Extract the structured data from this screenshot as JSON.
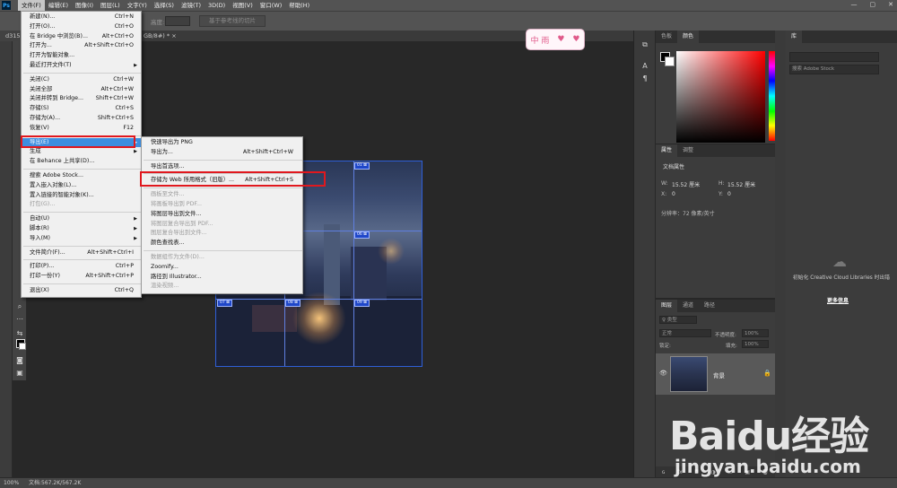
{
  "menubar": {
    "logo": "Ps",
    "items": [
      "文件(F)",
      "编辑(E)",
      "图像(I)",
      "图层(L)",
      "文字(Y)",
      "选择(S)",
      "滤镜(T)",
      "3D(D)",
      "视图(V)",
      "窗口(W)",
      "帮助(H)"
    ],
    "window_controls": [
      "—",
      "▢",
      "✕"
    ]
  },
  "options_bar": {
    "field_label": "高度:",
    "button": "基于参考线的切片"
  },
  "doc_tab": {
    "left": "d315",
    "title": "GB/8#) *",
    "close": "×"
  },
  "file_menu": [
    {
      "label": "新建(N)...",
      "shortcut": "Ctrl+N"
    },
    {
      "label": "打开(O)...",
      "shortcut": "Ctrl+O"
    },
    {
      "label": "在 Bridge 中浏览(B)...",
      "shortcut": "Alt+Ctrl+O"
    },
    {
      "label": "打开为...",
      "shortcut": "Alt+Shift+Ctrl+O"
    },
    {
      "label": "打开为智能对象...",
      "shortcut": ""
    },
    {
      "label": "最近打开文件(T)",
      "shortcut": "",
      "arrow": "▶"
    },
    {
      "sep": true
    },
    {
      "label": "关闭(C)",
      "shortcut": "Ctrl+W"
    },
    {
      "label": "关闭全部",
      "shortcut": "Alt+Ctrl+W"
    },
    {
      "label": "关闭并转到 Bridge...",
      "shortcut": "Shift+Ctrl+W"
    },
    {
      "label": "存储(S)",
      "shortcut": "Ctrl+S"
    },
    {
      "label": "存储为(A)...",
      "shortcut": "Shift+Ctrl+S"
    },
    {
      "label": "恢复(V)",
      "shortcut": "F12"
    },
    {
      "sep": true
    },
    {
      "label": "导出(E)",
      "shortcut": "",
      "arrow": "▶",
      "highlight": true
    },
    {
      "label": "生成",
      "shortcut": "",
      "arrow": "▶"
    },
    {
      "label": "在 Behance 上共享(D)...",
      "shortcut": ""
    },
    {
      "sep": true
    },
    {
      "label": "搜索 Adobe Stock...",
      "shortcut": ""
    },
    {
      "label": "置入嵌入对象(L)...",
      "shortcut": ""
    },
    {
      "label": "置入链接的智能对象(K)...",
      "shortcut": ""
    },
    {
      "label": "打包(G)...",
      "shortcut": "",
      "disabled": true
    },
    {
      "sep": true
    },
    {
      "label": "自动(U)",
      "shortcut": "",
      "arrow": "▶"
    },
    {
      "label": "脚本(R)",
      "shortcut": "",
      "arrow": "▶"
    },
    {
      "label": "导入(M)",
      "shortcut": "",
      "arrow": "▶"
    },
    {
      "sep": true
    },
    {
      "label": "文件简介(F)...",
      "shortcut": "Alt+Shift+Ctrl+I"
    },
    {
      "sep": true
    },
    {
      "label": "打印(P)...",
      "shortcut": "Ctrl+P"
    },
    {
      "label": "打印一份(Y)",
      "shortcut": "Alt+Shift+Ctrl+P"
    },
    {
      "sep": true
    },
    {
      "label": "退出(X)",
      "shortcut": "Ctrl+Q"
    }
  ],
  "export_submenu": [
    {
      "label": "快速导出为 PNG",
      "shortcut": ""
    },
    {
      "label": "导出为...",
      "shortcut": "Alt+Shift+Ctrl+W"
    },
    {
      "sep": true
    },
    {
      "label": "导出首选项...",
      "shortcut": ""
    },
    {
      "sep": true
    },
    {
      "label": "存储为 Web 所用格式（旧版）...",
      "shortcut": "Alt+Shift+Ctrl+S"
    },
    {
      "sep": true
    },
    {
      "label": "画板至文件...",
      "shortcut": "",
      "disabled": true
    },
    {
      "label": "将画板导出到 PDF...",
      "shortcut": "",
      "disabled": true
    },
    {
      "label": "将图层导出到文件...",
      "shortcut": ""
    },
    {
      "label": "将图层复合导出到 PDF...",
      "shortcut": "",
      "disabled": true
    },
    {
      "label": "图层复合导出到文件...",
      "shortcut": "",
      "disabled": true
    },
    {
      "label": "颜色查找表...",
      "shortcut": ""
    },
    {
      "sep": true
    },
    {
      "label": "数据组作为文件(D)...",
      "shortcut": "",
      "disabled": true
    },
    {
      "label": "Zoomify...",
      "shortcut": ""
    },
    {
      "label": "路径到 Illustrator...",
      "shortcut": ""
    },
    {
      "label": "渲染视频...",
      "shortcut": "",
      "disabled": true
    }
  ],
  "slices": [
    "01 ⊠",
    "06 ⊠",
    "07 ⊠",
    "08 ⊠",
    "09 ⊠"
  ],
  "sticker_text": "中 雨",
  "color_panel": {
    "tabs": [
      "色板",
      "颜色"
    ]
  },
  "properties_panel": {
    "tabs": [
      "属性",
      "调整"
    ],
    "section": "文档属性",
    "w_label": "W:",
    "w_value": "15.52 厘米",
    "h_label": "H:",
    "h_value": "15.52 厘米",
    "x_label": "X:",
    "x_value": "0",
    "y_label": "Y:",
    "y_value": "0",
    "resolution": "分辨率：72 像素/英寸"
  },
  "layers_panel": {
    "tabs": [
      "图层",
      "通道",
      "路径"
    ],
    "filter": "♀ 类型",
    "blend": "正常",
    "opacity_label": "不透明度:",
    "opacity": "100%",
    "lock_label": "锁定:",
    "fill_label": "填充:",
    "fill": "100%",
    "layer_name": "背景",
    "bottom_icons": [
      "ɢ",
      "fx",
      "◘",
      "◑",
      "▭",
      "▣",
      "🗑"
    ]
  },
  "libraries_panel": {
    "tab": "库",
    "search_placeholder": "搜索 Adobe Stock",
    "message": "初始化 Creative Cloud Libraries 时出错",
    "link": "更多信息"
  },
  "statusbar": {
    "zoom": "100%",
    "doc": "文档:567.2K/567.2K"
  },
  "watermark": {
    "logo": "Baidu经验",
    "url": "jingyan.baidu.com"
  },
  "colors": {
    "accent": "#3d8ee0",
    "highlight_box": "#e0181e",
    "slice": "#1f47c9"
  }
}
